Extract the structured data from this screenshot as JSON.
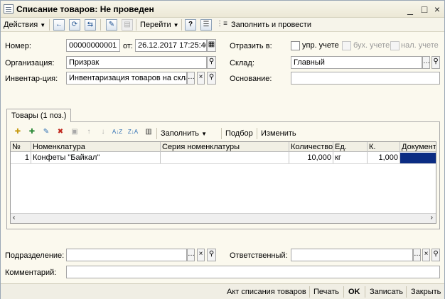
{
  "window": {
    "title": "Списание товаров: Не проведен",
    "controls": [
      "_",
      "□",
      "×"
    ]
  },
  "toolbar": {
    "actions_label": "Действия",
    "goto_label": "Перейти",
    "help_label": "?",
    "fill_post_label": "Заполнить и провести"
  },
  "form": {
    "number_label": "Номер:",
    "number_value": "00000000001",
    "from_label": "от:",
    "date_value": "26.12.2017 17:25:46",
    "org_label": "Организация:",
    "org_value": "Призрак",
    "inventory_label": "Инвентар-ция:",
    "inventory_value": "Инвентаризация товаров на скла...",
    "reflect_label": "Отразить в:",
    "reflect_options": [
      {
        "label": "упр. учете",
        "checked": false,
        "enabled": true
      },
      {
        "label": "бух. учете",
        "checked": false,
        "enabled": false
      },
      {
        "label": "нал. учете",
        "checked": false,
        "enabled": false
      }
    ],
    "warehouse_label": "Склад:",
    "warehouse_value": "Главный",
    "basis_label": "Основание:",
    "basis_value": "",
    "dept_label": "Подразделение:",
    "dept_value": "",
    "responsible_label": "Ответственный:",
    "responsible_value": "",
    "comment_label": "Комментарий:",
    "comment_value": ""
  },
  "tab": {
    "label": "Товары (1 поз.)"
  },
  "table_toolbar": {
    "fill_label": "Заполнить",
    "select_label": "Подбор",
    "change_label": "Изменить"
  },
  "table": {
    "columns": [
      "№",
      "Номенклатура",
      "Серия номенклатуры",
      "Количество",
      "Ед.",
      "К.",
      "Документ"
    ],
    "rows": [
      [
        "1",
        "Конфеты \"Байкал\"",
        "",
        "10,000",
        "кг",
        "1,000",
        ""
      ]
    ]
  },
  "bottom": {
    "act_label": "Акт списания товаров",
    "print_label": "Печать",
    "ok_label": "OK",
    "save_label": "Записать",
    "close_label": "Закрыть"
  }
}
